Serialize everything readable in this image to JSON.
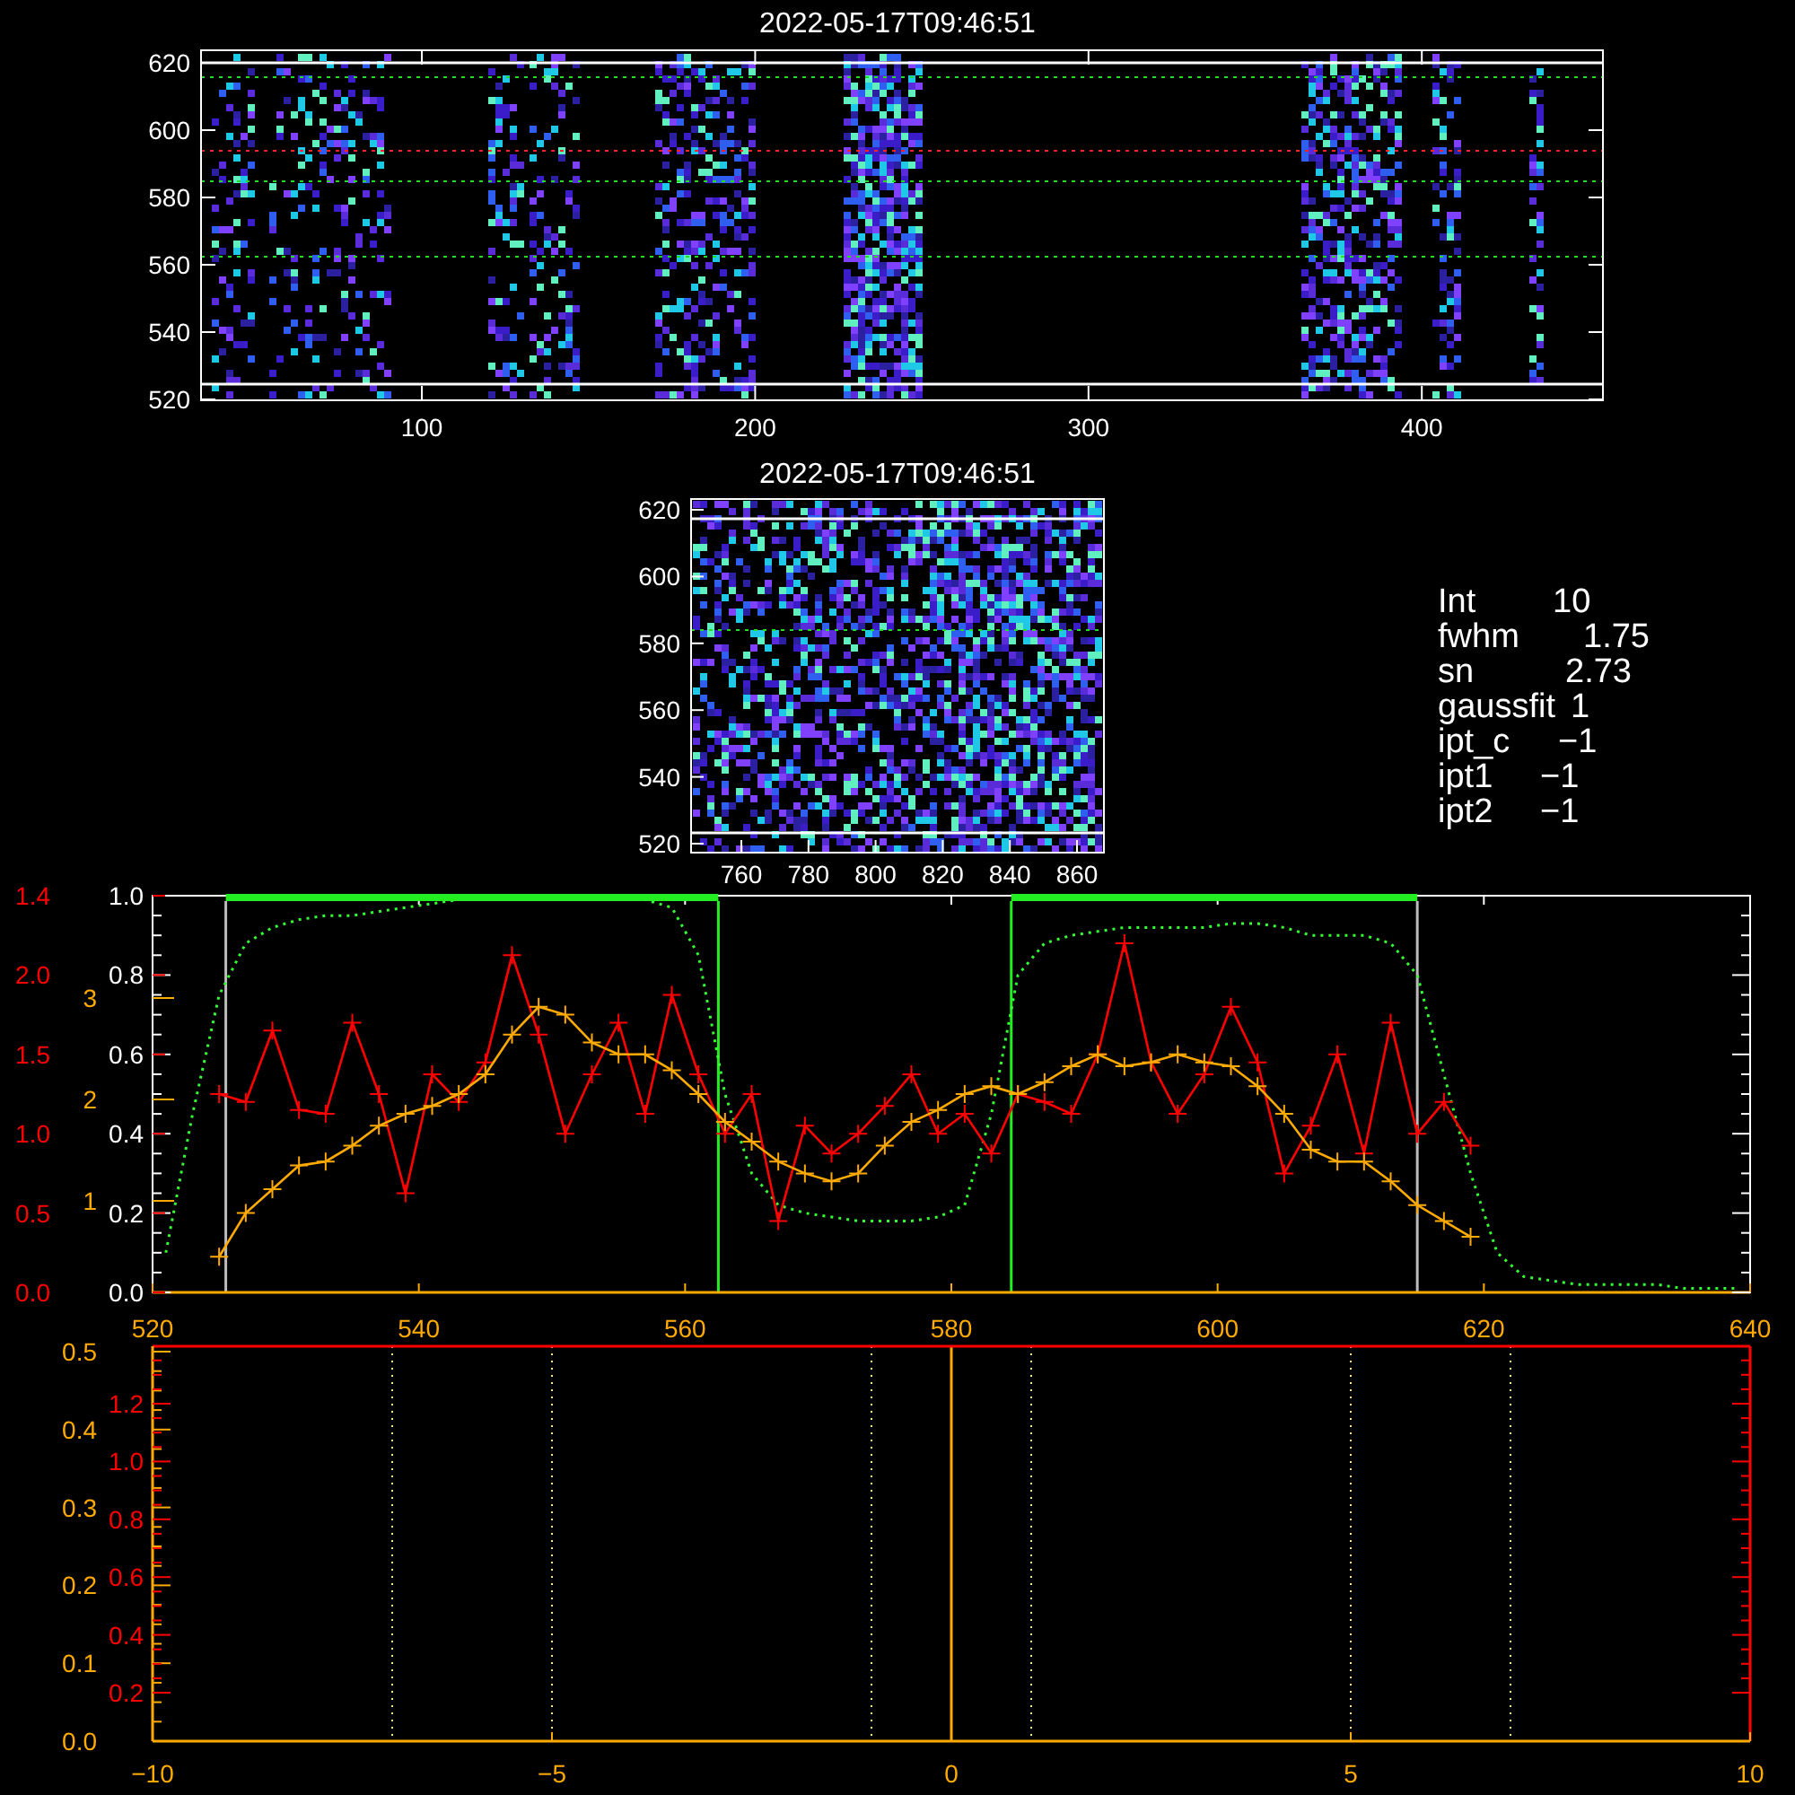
{
  "top_image": {
    "title": "2022-05-17T09:46:51",
    "x_ticks": [
      "100",
      "200",
      "300",
      "400"
    ],
    "y_ticks": [
      "620",
      "600",
      "580",
      "560",
      "540",
      "520"
    ]
  },
  "cutout_image": {
    "title": "2022-05-17T09:46:51",
    "x_ticks": [
      "760",
      "780",
      "800",
      "820",
      "840",
      "860"
    ],
    "y_ticks": [
      "620",
      "600",
      "580",
      "560",
      "540",
      "520"
    ]
  },
  "fit_parameters": [
    {
      "label": "Int",
      "value": "10"
    },
    {
      "label": "fwhm",
      "value": "1.75"
    },
    {
      "label": "sn",
      "value": "2.73"
    },
    {
      "label": "gaussfit",
      "value": "1"
    },
    {
      "label": "ipt_c",
      "value": "−1"
    },
    {
      "label": "ipt1",
      "value": "−1"
    },
    {
      "label": "ipt2",
      "value": "−1"
    }
  ],
  "profile_plot": {
    "y_axes": [
      {
        "color": "#ff0000",
        "ticks": [
          "1.4",
          "2.0",
          "1.5",
          "1.0",
          "0.5",
          "0.0"
        ]
      },
      {
        "color": "#ffaa00",
        "ticks": [
          "3",
          "2",
          "1"
        ]
      }
    ],
    "chart_data": {
      "type": "line",
      "xlim": [
        520,
        640
      ],
      "ylim": [
        0,
        1
      ],
      "xticks": [
        520,
        540,
        560,
        580,
        600,
        620,
        640
      ],
      "yticks": [
        {
          "value": 0,
          "label": "0.0"
        },
        {
          "value": 0.2,
          "label": "0.2"
        },
        {
          "value": 0.4,
          "label": "0.4"
        },
        {
          "value": 0.6,
          "label": "0.6"
        },
        {
          "value": 0.8,
          "label": "0.8"
        },
        {
          "value": 1,
          "label": "1.0"
        }
      ],
      "x": [
        521,
        523,
        525,
        527,
        529,
        531,
        533,
        535,
        537,
        539,
        541,
        543,
        545,
        547,
        549,
        551,
        553,
        555,
        557,
        559,
        561,
        563,
        565,
        567,
        569,
        571,
        573,
        575,
        577,
        579,
        581,
        583,
        585,
        587,
        589,
        591,
        593,
        595,
        597,
        599,
        601,
        603,
        605,
        607,
        609,
        611,
        613,
        615,
        617,
        619,
        621,
        623,
        625,
        627,
        629,
        631,
        633,
        635,
        637,
        639
      ],
      "series": [
        {
          "color": "#33ff33",
          "line_style": "dotted",
          "values": [
            0.1,
            0.45,
            0.75,
            0.88,
            0.92,
            0.94,
            0.95,
            0.95,
            0.96,
            0.97,
            0.98,
            0.99,
            1.0,
            1.0,
            1.0,
            1.0,
            1.0,
            1.0,
            0.99,
            0.97,
            0.85,
            0.5,
            0.3,
            0.22,
            0.2,
            0.19,
            0.18,
            0.18,
            0.18,
            0.19,
            0.22,
            0.45,
            0.8,
            0.88,
            0.9,
            0.91,
            0.92,
            0.92,
            0.92,
            0.92,
            0.93,
            0.93,
            0.92,
            0.9,
            0.9,
            0.9,
            0.88,
            0.8,
            0.55,
            0.3,
            0.1,
            0.04,
            0.03,
            0.02,
            0.02,
            0.02,
            0.02,
            0.01,
            0.01,
            0.01
          ]
        },
        {
          "color": "#ff0000",
          "marker": "+",
          "values": [
            null,
            null,
            0.5,
            0.48,
            0.66,
            0.46,
            0.45,
            0.68,
            0.5,
            0.25,
            0.55,
            0.48,
            0.58,
            0.85,
            0.65,
            0.4,
            0.55,
            0.68,
            0.45,
            0.75,
            0.55,
            0.4,
            0.5,
            0.18,
            0.42,
            0.35,
            0.4,
            0.47,
            0.55,
            0.4,
            0.45,
            0.35,
            0.5,
            0.48,
            0.45,
            0.6,
            0.88,
            0.58,
            0.45,
            0.55,
            0.72,
            0.58,
            0.3,
            0.42,
            0.6,
            0.35,
            0.68,
            0.4,
            0.48,
            0.37,
            null,
            null,
            null,
            null,
            null,
            null,
            null,
            null,
            null,
            null
          ]
        },
        {
          "color": "#ffaa00",
          "marker": "+",
          "values": [
            null,
            null,
            0.09,
            0.2,
            0.26,
            0.32,
            0.33,
            0.37,
            0.42,
            0.45,
            0.47,
            0.5,
            0.55,
            0.65,
            0.72,
            0.7,
            0.63,
            0.6,
            0.6,
            0.56,
            0.5,
            0.43,
            0.38,
            0.33,
            0.3,
            0.28,
            0.3,
            0.37,
            0.43,
            0.46,
            0.5,
            0.52,
            0.5,
            0.53,
            0.57,
            0.6,
            0.57,
            0.58,
            0.6,
            0.58,
            0.57,
            0.52,
            0.45,
            0.36,
            0.33,
            0.33,
            0.28,
            0.22,
            0.18,
            0.14,
            null,
            null,
            null,
            null,
            null,
            null,
            null,
            null,
            null,
            null
          ]
        }
      ],
      "ref_lines": [
        {
          "axis": "x",
          "value": 525.5,
          "color": "#bbbbbb"
        },
        {
          "axis": "x",
          "value": 562.5,
          "color": "#22ee22"
        },
        {
          "axis": "x",
          "value": 584.5,
          "color": "#22ee22"
        },
        {
          "axis": "x",
          "value": 615,
          "color": "#bbbbbb"
        }
      ]
    }
  },
  "offset_plot": {
    "x_ticks": [
      "−10",
      "−5",
      "0",
      "5",
      "10"
    ],
    "y_axes": [
      {
        "color": "#ffaa00",
        "ticks": [
          "0.5",
          "0.4",
          "0.3",
          "0.2",
          "0.1",
          "0.0"
        ]
      },
      {
        "color": "#ff0000",
        "ticks": [
          "1.2",
          "1.0",
          "0.8",
          "0.6",
          "0.4",
          "0.2"
        ]
      }
    ]
  }
}
